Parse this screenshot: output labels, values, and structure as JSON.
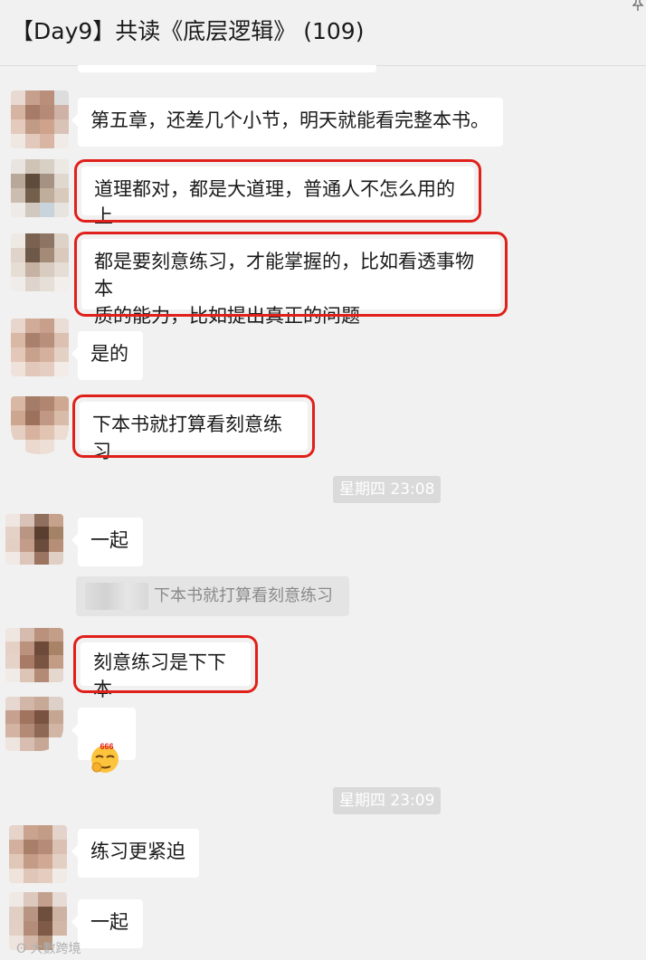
{
  "header": {
    "title": "【Day9】共读《底层逻辑》 (109)",
    "pin_icon": "pin-icon"
  },
  "messages": [
    {
      "text": "第五章，还差几个小节，明天就能看完整本书。",
      "highlighted": false
    },
    {
      "text": "道理都对，都是大道理，普通人不怎么用的上",
      "highlighted": true
    },
    {
      "text": "都是要刻意练习，才能掌握的，比如看透事物本\n质的能力，比如提出真正的问题",
      "highlighted": true
    },
    {
      "text": "是的",
      "highlighted": false
    },
    {
      "text": "下本书就打算看刻意练习",
      "highlighted": true
    },
    {
      "text": "一起",
      "highlighted": false
    },
    {
      "text": "刻意练习是下下本",
      "highlighted": true
    },
    {
      "emoji": "666-emoji"
    },
    {
      "text": "练习更紧迫",
      "highlighted": false
    },
    {
      "text": "一起",
      "highlighted": false
    }
  ],
  "timestamps": [
    "星期四 23:08",
    "星期四 23:09"
  ],
  "quote": {
    "text": "下本书就打算看刻意练习"
  },
  "emoji_label": "666",
  "highlight_color": "#e0201a",
  "watermark": "大數跨境"
}
